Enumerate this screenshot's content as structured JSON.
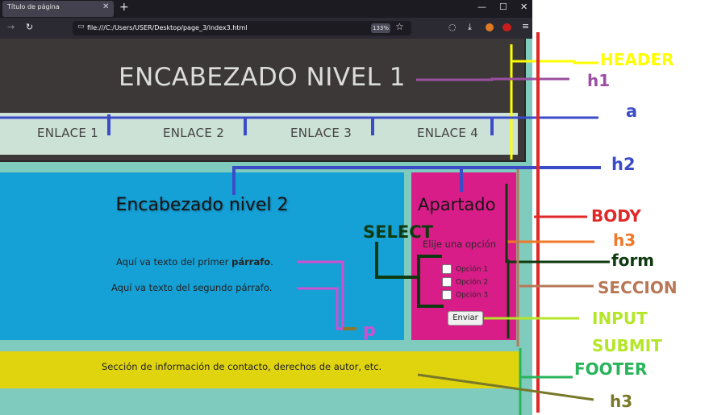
{
  "browser": {
    "tab_title": "Título de página",
    "tab_close_icon": "close-icon",
    "new_tab_icon": "plus-icon",
    "url": "file:///C:/Users/USER/Desktop/page_3/index3.html",
    "zoom": "133%",
    "window_controls": [
      "minimize",
      "maximize",
      "close"
    ]
  },
  "page": {
    "h1": "ENCABEZADO NIVEL 1",
    "nav_links": [
      "ENLACE 1",
      "ENLACE 2",
      "ENLACE 3",
      "ENLACE 4"
    ],
    "main_h2": "Encabezado nivel 2",
    "paragraph1_text": "Aquí va texto del primer ",
    "paragraph1_bold": "párrafo",
    "paragraph1_end": ".",
    "paragraph2": "Aquí va texto del segundo párrafo.",
    "aside_h2": "Apartado",
    "aside_h3": "Elije una opción",
    "options": [
      "Opción 1",
      "Opción 2",
      "Opción 3"
    ],
    "submit_label": "Enviar",
    "footer_text": "Sección de información de contacto, derechos de autor, etc."
  },
  "annotations": {
    "header": "HEADER",
    "h1": "h1",
    "a": "a",
    "h2": "h2",
    "body": "BODY",
    "h3": "h3",
    "form": "form",
    "select": "SELECT",
    "seccion": "SECCION",
    "input": "INPUT",
    "submit": "SUBMIT",
    "footer": "FOOTER",
    "h3_footer": "h3",
    "p": "p"
  },
  "colors": {
    "header": "#ffff00",
    "h1": "#9b4fa0",
    "a": "#3c4bc8",
    "body": "#e02828",
    "h3": "#f07828",
    "form": "#0f3a0f",
    "seccion": "#b87858",
    "input": "#b4e628",
    "footer": "#28b45a",
    "h3_footer": "#787828",
    "p": "#d050d0"
  }
}
